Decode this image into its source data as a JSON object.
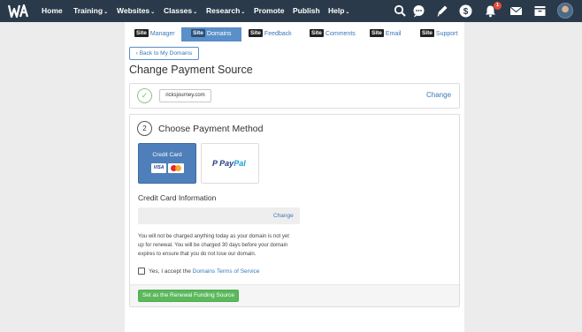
{
  "topnav": {
    "logo_text": "WA",
    "items": [
      {
        "label": "Home",
        "dropdown": false
      },
      {
        "label": "Training",
        "dropdown": true
      },
      {
        "label": "Websites",
        "dropdown": true
      },
      {
        "label": "Classes",
        "dropdown": true
      },
      {
        "label": "Research",
        "dropdown": true
      },
      {
        "label": "Promote",
        "dropdown": false
      },
      {
        "label": "Publish",
        "dropdown": false
      },
      {
        "label": "Help",
        "dropdown": true
      }
    ],
    "icons": [
      "search-icon",
      "chat-icon",
      "pencil-icon",
      "dollar-icon",
      "bell-icon",
      "mail-icon",
      "inbox-icon",
      "avatar"
    ],
    "notification_count": "1",
    "caret": "⌄"
  },
  "tabs": [
    {
      "badge": "Site",
      "label": "Manager",
      "active": false
    },
    {
      "badge": "Site",
      "label": "Domains",
      "active": true
    },
    {
      "badge": "Site",
      "label": "Feedback",
      "active": false
    },
    {
      "badge": "Site",
      "label": "Comments",
      "active": false
    },
    {
      "badge": "Site",
      "label": "Email",
      "active": false
    },
    {
      "badge": "Site",
      "label": "Support",
      "active": false
    }
  ],
  "back_button": "Back to My Domains",
  "page_title": "Change Payment Source",
  "domain": {
    "value": "ricksjourney.com",
    "change_label": "Change"
  },
  "payment": {
    "step_number": "2",
    "step_title": "Choose Payment Method",
    "credit_card_label": "Credit Card",
    "visa_text": "VISA",
    "paypal_pay": "Pay",
    "paypal_pal": "Pal",
    "cc_info_title": "Credit Card Information",
    "cc_change_label": "Change",
    "notice_lines": [
      "You will not be charged anything today as your domain is not yet",
      "up for renewal. You will be charged 30 days before your domain",
      "expires to ensure that you do not lose our domain."
    ],
    "terms_prefix": "Yes, I accept the ",
    "terms_link": "Domains Terms of Service",
    "submit_label": "Set as the Renewal Funding Source"
  },
  "colors": {
    "nav_bg": "#2b3a4a",
    "accent": "#5a8fc9",
    "link": "#3a78b8",
    "success": "#5cb85c"
  }
}
